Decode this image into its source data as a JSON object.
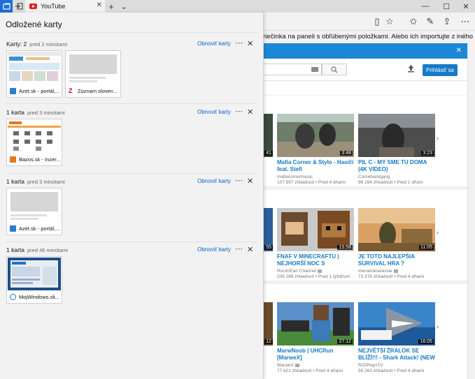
{
  "browser": {
    "active_tab_title": "YouTube",
    "favorites_notice": "riečinka na paneli s obľúbenými položkami. Alebo ich importujte z iného prehliad"
  },
  "panel": {
    "title": "Odložené karty",
    "restore_label": "Obnoviť karty",
    "groups": [
      {
        "count": "Karty: 2",
        "time": "pred 2 minútami",
        "tabs": [
          "Azet.sk - portál,...",
          "Zoznam sloven..."
        ]
      },
      {
        "count": "1 karta",
        "time": "pred 3 minútami",
        "tabs": [
          "Bazos.sk - Inzer..."
        ]
      },
      {
        "count": "1 karta",
        "time": "pred 3 minútami",
        "tabs": [
          "Azet.sk - portál,..."
        ]
      },
      {
        "count": "1 karta",
        "time": "pred 46 minútami",
        "tabs": [
          "MojWindows.sk..."
        ]
      }
    ]
  },
  "youtube": {
    "signin_label": "Prihlásiť sa",
    "rows": [
      {
        "partial_duration": "41",
        "videos": [
          {
            "title": "Mafia Corner & Stylo - Hasiči feat. Stefi",
            "channel": "mafiacornermusic",
            "meta": "107 997 zhliadnutí • Pred 4 dňami",
            "duration": "3:48"
          },
          {
            "title": "PIL C - MY SME TU DOMA (4K VIDEO)",
            "channel": "Comebackgang",
            "meta": "96 164 zhliadnutí • Pred 1 dňom",
            "duration": "3:23"
          }
        ]
      },
      {
        "partial_duration": "55",
        "videos": [
          {
            "title": "FNAF V MINECRAFTU | NEJHORŠÍ NOC S FREDDYM !!",
            "channel": "RoUmEan Channel",
            "meta": "206 286 zhliadnutí • Pred 1 týždňom",
            "duration": "15:58"
          },
          {
            "title": "JE TOTO NAJLEPŠIA SURVIVAL HRA ?",
            "channel": "menameselassie",
            "meta": "73 376 zhliadnutí • Pred 4 dňami",
            "duration": "11:05"
          }
        ]
      },
      {
        "partial_duration": "12",
        "videos": [
          {
            "title": "MarwNoob | UHCRun [MarweX]",
            "channel": "MarweX",
            "meta": "77 621 zhliadnutí • Pred 4 dňami",
            "duration": "27:12"
          },
          {
            "title": "NEJVĚTŠÍ ŽRALOK SE BLÍŽÍ!!! - Shark Attack! (NEW UPDATE) -",
            "channel": "RiZiPlaysTV",
            "meta": "55 263 zhliadnutí • Pred 4 dňami",
            "duration": "16:05"
          }
        ]
      }
    ]
  }
}
